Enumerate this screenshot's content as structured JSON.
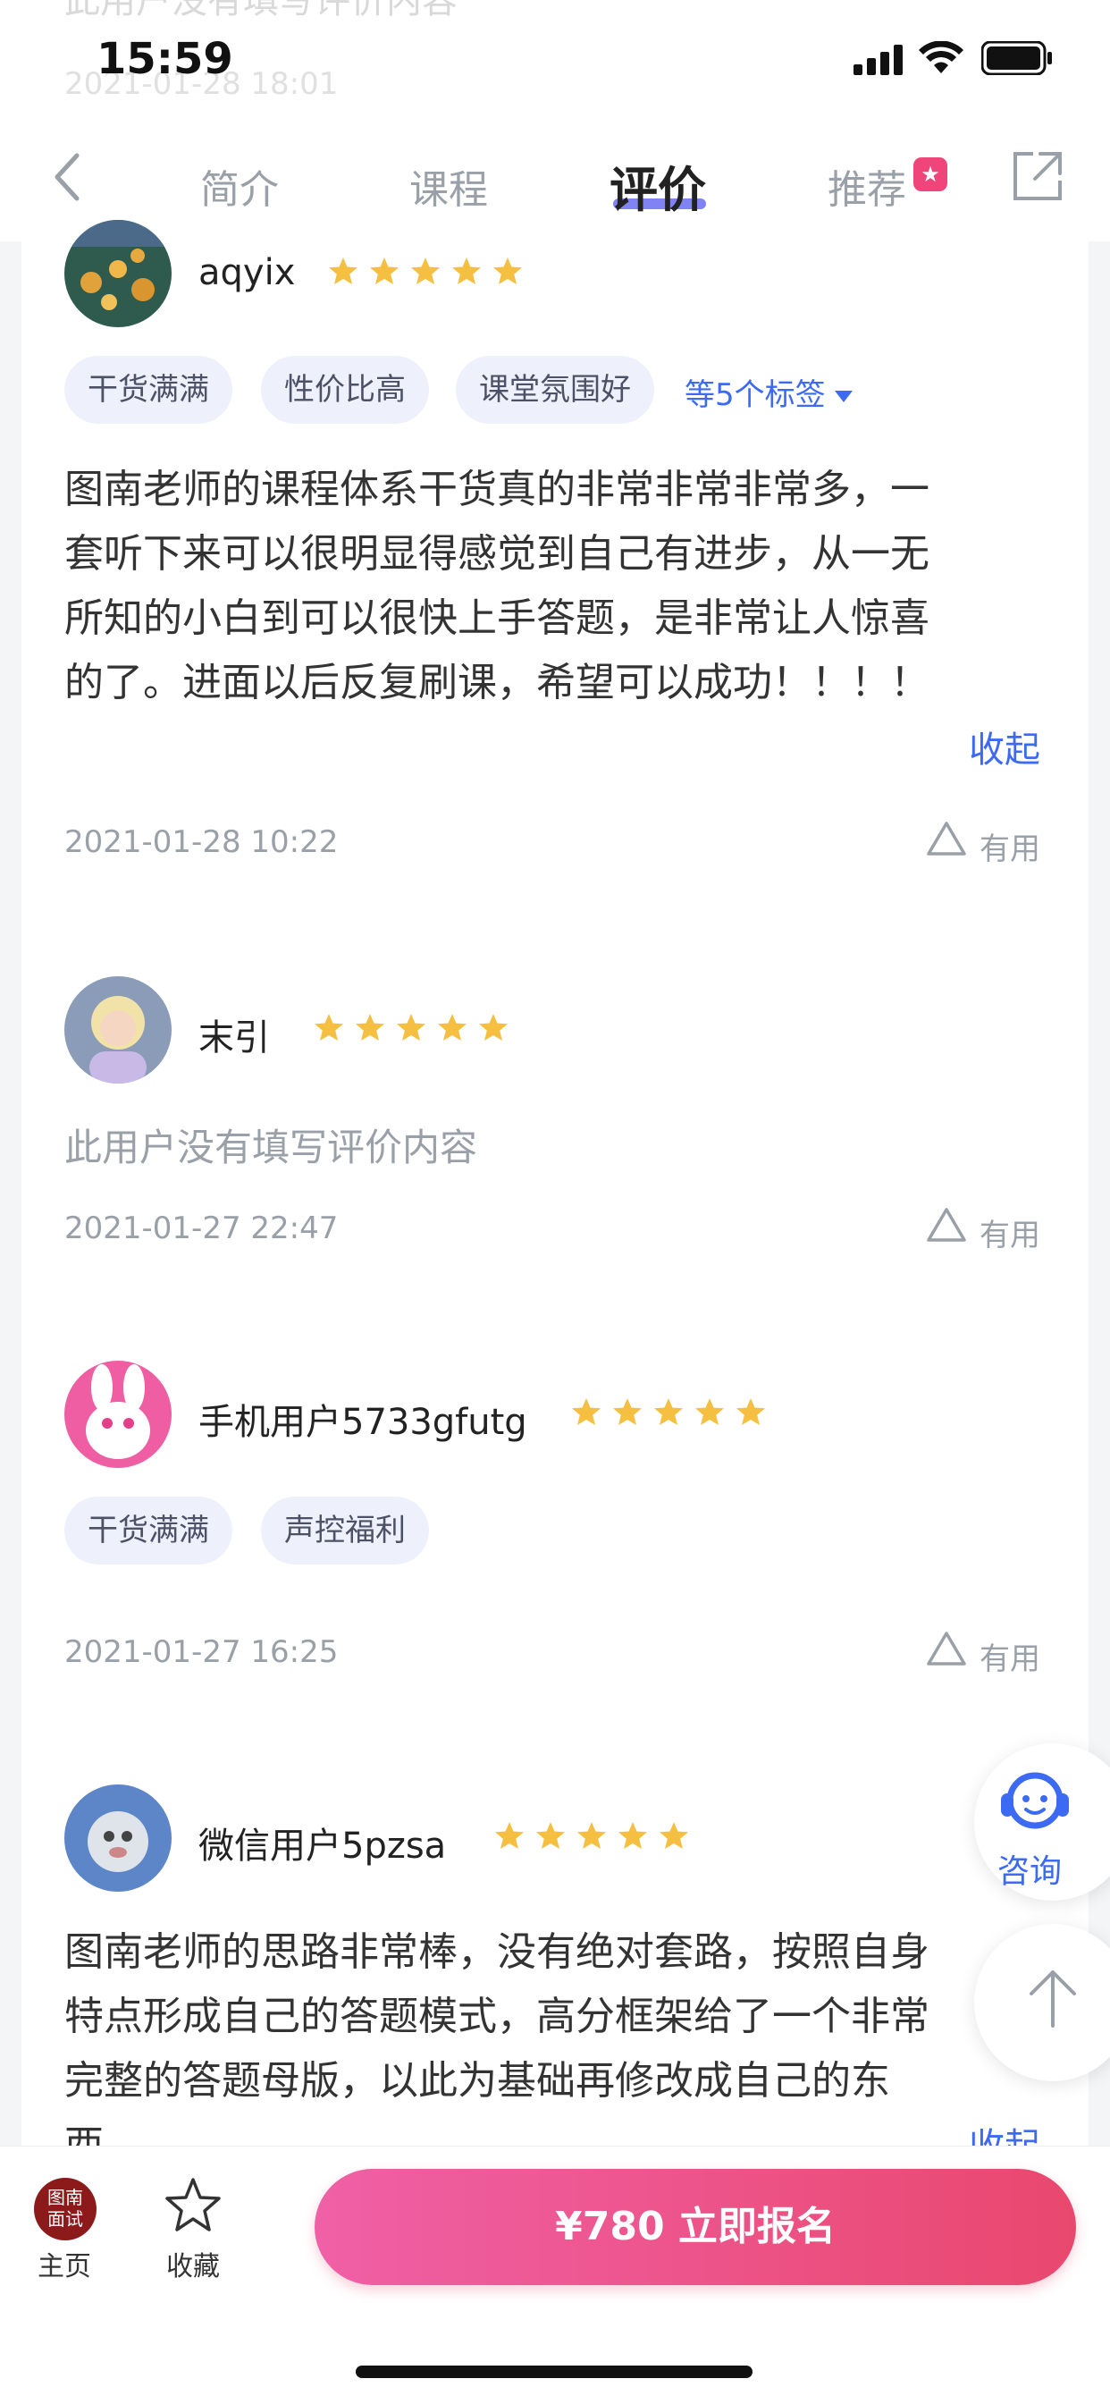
{
  "status_bar": {
    "time": "15:59"
  },
  "ghost": {
    "top_text": "此用户没有填写评价内容",
    "top_date": "2021-01-28 18:01"
  },
  "nav": {
    "tabs": [
      {
        "label": "简介"
      },
      {
        "label": "课程"
      },
      {
        "label": "评价",
        "active": true
      },
      {
        "label": "推荐"
      }
    ],
    "rec_badge_glyph": "★"
  },
  "reviews": [
    {
      "username": "aqyix",
      "rating": 5,
      "tags": [
        "干货满满",
        "性价比高",
        "课堂氛围好"
      ],
      "more_tags": "等5个标签",
      "content_lines": [
        "图南老师的课程体系干货真的非常非常非常多，一",
        "套听下来可以很明显得感觉到自己有进步，从一无",
        "所知的小白到可以很快上手答题，是非常让人惊喜",
        "的了。进面以后反复刷课，希望可以成功！！！！"
      ],
      "collapse": "收起",
      "date": "2021-01-28 10:22",
      "useful": "有用"
    },
    {
      "username": "末引",
      "rating": 5,
      "empty": "此用户没有填写评价内容",
      "date": "2021-01-27 22:47",
      "useful": "有用"
    },
    {
      "username": "手机用户5733gfutg",
      "rating": 5,
      "tags": [
        "干货满满",
        "声控福利"
      ],
      "date": "2021-01-27 16:25",
      "useful": "有用"
    },
    {
      "username": "微信用户5pzsa",
      "rating": 5,
      "content_lines": [
        "图南老师的思路非常棒，没有绝对套路，按照自身",
        "特点形成自己的答题模式，高分框架给了一个非常",
        "完整的答题母版，以此为基础再修改成自己的东",
        "西。"
      ],
      "collapse": "收起"
    }
  ],
  "floating": {
    "consult": "咨询"
  },
  "bottom_bar": {
    "logo_lines": [
      "图南",
      "面试"
    ],
    "home": "主页",
    "favorite": "收藏",
    "cta": "¥780  立即报名"
  },
  "colors": {
    "accent": "#3d6af2",
    "star": "#f5c042",
    "cta_start": "#f060a6",
    "cta_end": "#e9486e"
  }
}
